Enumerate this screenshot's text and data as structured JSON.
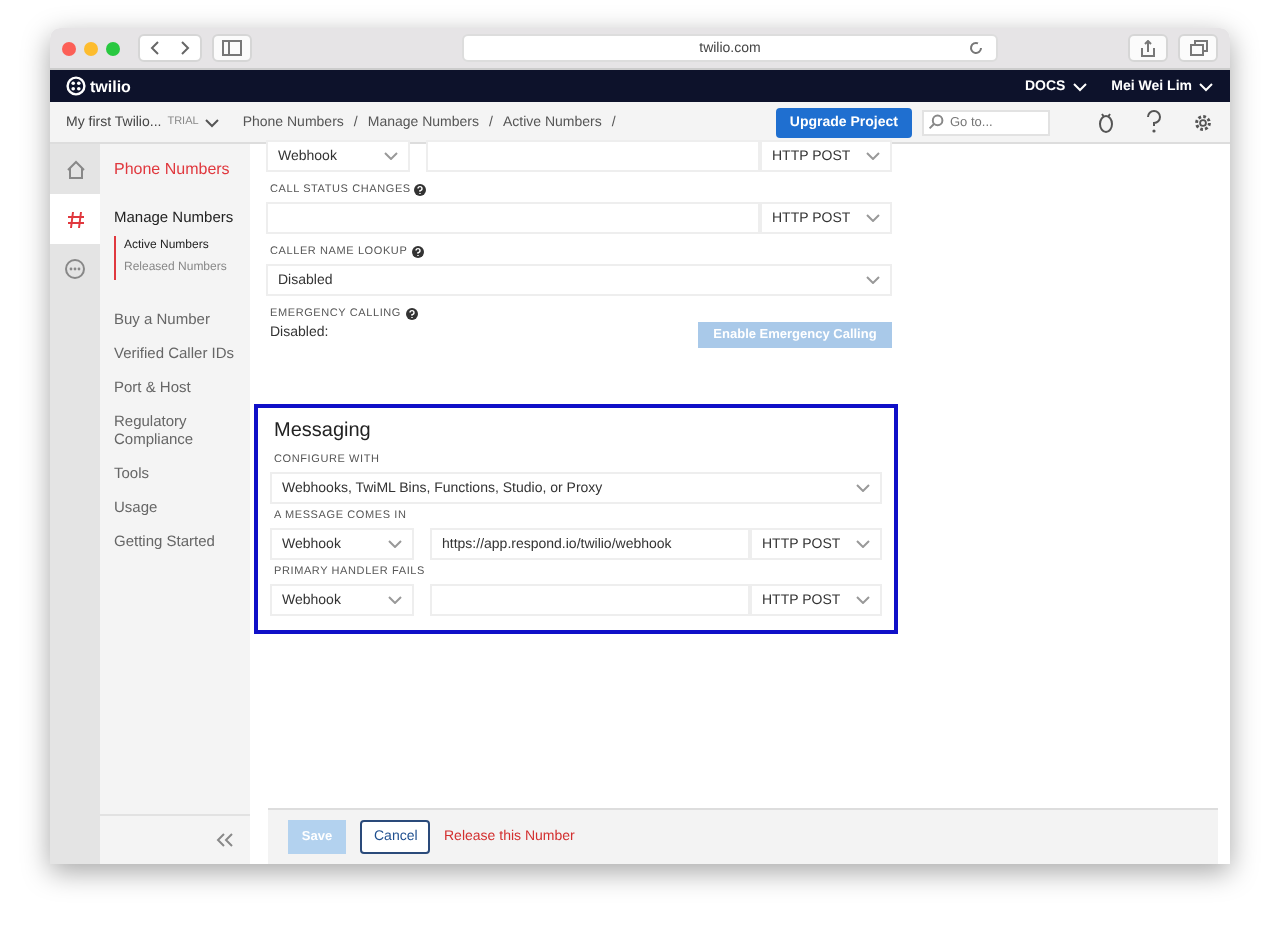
{
  "browser": {
    "url": "twilio.com"
  },
  "topbar": {
    "logo": "twilio",
    "docs": "DOCS",
    "user": "Mei Wei Lim"
  },
  "subbar": {
    "project": "My first Twilio...",
    "badge": "TRIAL",
    "breadcrumb": [
      {
        "label": "Phone Numbers",
        "separator": "/"
      },
      {
        "label": "Manage Numbers",
        "separator": "/"
      },
      {
        "label": "Active Numbers",
        "separator": "/"
      }
    ],
    "upgrade": "Upgrade Project",
    "search": {
      "placeholder": "Go to..."
    }
  },
  "rail": [
    {
      "kind": "home",
      "selected": false
    },
    {
      "kind": "hash",
      "selected": true
    },
    {
      "kind": "more",
      "selected": false
    }
  ],
  "sidebar": {
    "title": "Phone Numbers",
    "items": [
      {
        "label": "Manage Numbers",
        "selected": false,
        "children": [
          {
            "label": "Active Numbers",
            "selected": true
          },
          {
            "label": "Released Numbers",
            "selected": false
          }
        ]
      },
      {
        "label": "Buy a Number",
        "selected": false
      },
      {
        "label": "Verified Caller IDs",
        "selected": false
      },
      {
        "label": "Port & Host",
        "selected": false
      },
      {
        "label": "Regulatory Compliance",
        "selected": false
      },
      {
        "label": "Tools",
        "selected": false
      },
      {
        "label": "Usage",
        "selected": false
      },
      {
        "label": "Getting Started",
        "selected": false
      }
    ]
  },
  "voice_fields": [
    {
      "kind": "webhook",
      "type": "Webhook",
      "method": "HTTP POST"
    },
    {
      "kind": "url",
      "label": "CALL STATUS CHANGES",
      "help": true,
      "method": "HTTP POST"
    },
    {
      "kind": "select",
      "label": "CALLER NAME LOOKUP",
      "help": true,
      "value": "Disabled"
    },
    {
      "kind": "emergency",
      "label": "EMERGENCY CALLING",
      "help": true,
      "status": "Disabled:",
      "button": "Enable Emergency Calling",
      "disabled": true
    }
  ],
  "messaging": {
    "title": "Messaging",
    "highlighted": true,
    "fields": [
      {
        "kind": "select",
        "label": "CONFIGURE WITH",
        "value": "Webhooks, TwiML Bins, Functions, Studio, or Proxy"
      },
      {
        "kind": "webhook",
        "label": "A MESSAGE COMES IN",
        "type": "Webhook",
        "url": "https://app.respond.io/twilio/webhook",
        "method": "HTTP POST"
      },
      {
        "kind": "webhook",
        "label": "PRIMARY HANDLER FAILS",
        "type": "Webhook",
        "method": "HTTP POST"
      }
    ]
  },
  "footer": {
    "save": {
      "label": "Save",
      "disabled": true
    },
    "cancel": "Cancel",
    "release": "Release this Number"
  }
}
